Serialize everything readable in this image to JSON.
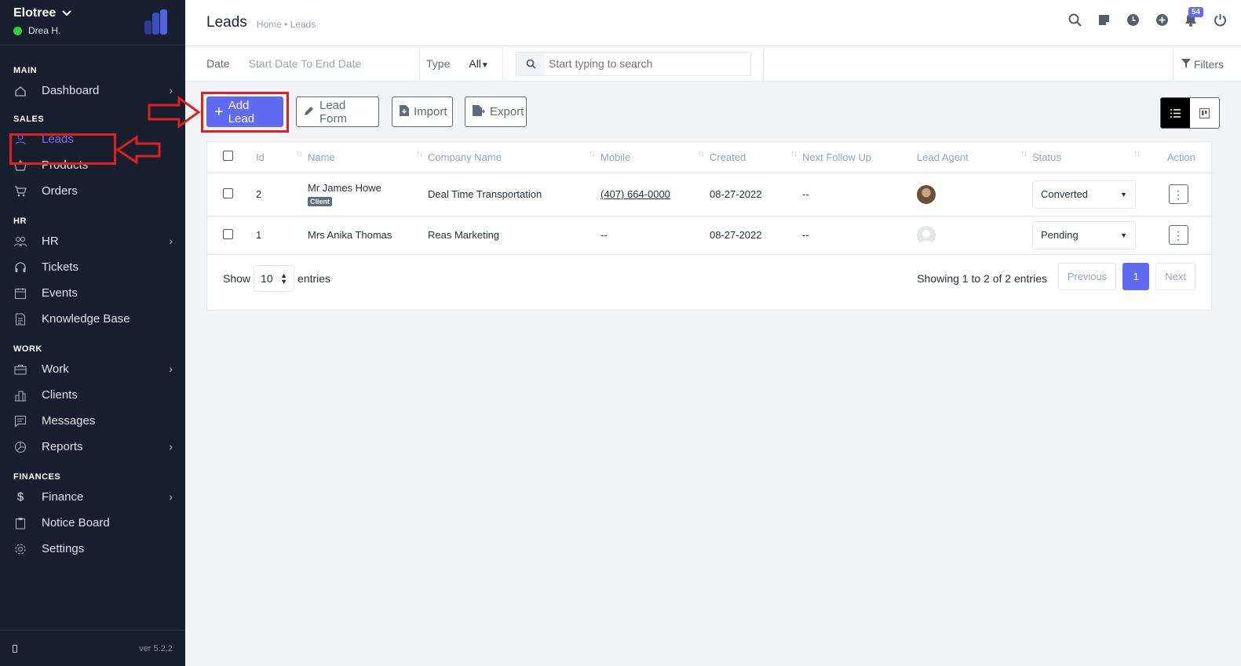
{
  "app": {
    "company": "Elotree",
    "user": "Drea H.",
    "version": "ver 5.2.2"
  },
  "sidebar": {
    "sections": {
      "main": "MAIN",
      "sales": "SALES",
      "hr": "HR",
      "work": "WORK",
      "finances": "FINANCES"
    },
    "items": {
      "dashboard": "Dashboard",
      "leads": "Leads",
      "products": "Products",
      "orders": "Orders",
      "hr": "HR",
      "tickets": "Tickets",
      "events": "Events",
      "knowledge_base": "Knowledge Base",
      "work": "Work",
      "clients": "Clients",
      "messages": "Messages",
      "reports": "Reports",
      "finance": "Finance",
      "notice_board": "Notice Board",
      "settings": "Settings"
    }
  },
  "header": {
    "title": "Leads",
    "breadcrumb": "Home • Leads",
    "notification_count": "54"
  },
  "filters": {
    "date_label": "Date",
    "date_placeholder": "Start Date To End Date",
    "type_label": "Type",
    "type_value": "All",
    "search_placeholder": "Start typing to search",
    "filters_label": "Filters"
  },
  "actions": {
    "add_lead": "Add Lead",
    "lead_form": "Lead Form",
    "import": "Import",
    "export": "Export"
  },
  "table": {
    "columns": [
      "Id",
      "Name",
      "Company Name",
      "Mobile",
      "Created",
      "Next Follow Up",
      "Lead Agent",
      "Status",
      "Action"
    ],
    "rows": [
      {
        "id": "2",
        "name": "Mr James Howe",
        "tag": "Client",
        "company": "Deal Time Transportation",
        "mobile": "(407) 664-0000",
        "created": "08-27-2022",
        "follow_up": "--",
        "status": "Converted"
      },
      {
        "id": "1",
        "name": "Mrs Anika Thomas",
        "tag": "",
        "company": "Reas Marketing",
        "mobile": "--",
        "created": "08-27-2022",
        "follow_up": "--",
        "status": "Pending"
      }
    ],
    "footer": {
      "show": "Show",
      "page_length": "10",
      "entries": "entries",
      "info": "Showing 1 to 2 of 2 entries",
      "previous": "Previous",
      "current_page": "1",
      "next": "Next"
    }
  },
  "colors": {
    "sidebar_bg": "#171f2e",
    "accent": "#616af2",
    "annotation_red": "#e0201e",
    "online": "#2fce3b"
  }
}
